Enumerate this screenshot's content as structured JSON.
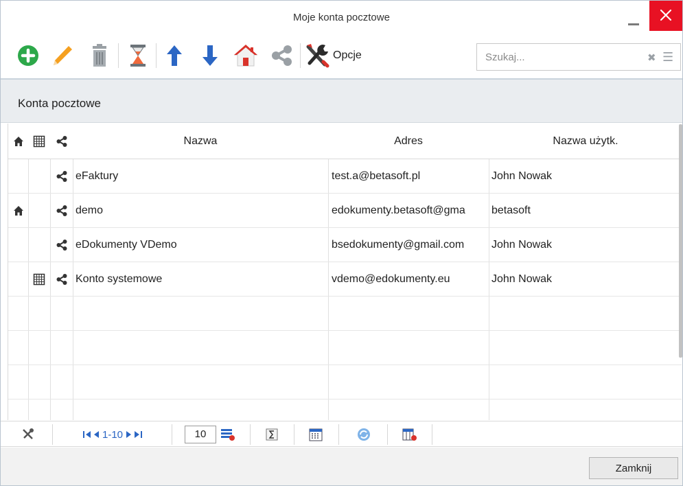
{
  "window": {
    "title": "Moje konta pocztowe"
  },
  "toolbar": {
    "opcje_label": "Opcje",
    "search_placeholder": "Szukaj...",
    "icons": [
      "plus-circle-icon",
      "pencil-icon",
      "trash-icon",
      "hourglass-icon",
      "arrow-up-icon",
      "arrow-down-icon",
      "home-icon",
      "share-icon",
      "tools-icon"
    ]
  },
  "section": {
    "title": "Konta pocztowe"
  },
  "table": {
    "headers": {
      "home": "",
      "calendar": "",
      "share": "",
      "name": "Nazwa",
      "address": "Adres",
      "username": "Nazwa użytk."
    },
    "rows": [
      {
        "home": false,
        "system": false,
        "shared": true,
        "name": "eFaktury",
        "address": "test.a@betasoft.pl",
        "username": "John Nowak"
      },
      {
        "home": true,
        "system": false,
        "shared": true,
        "name": "demo",
        "address": "edokumenty.betasoft@gma",
        "username": "betasoft"
      },
      {
        "home": false,
        "system": false,
        "shared": true,
        "name": "eDokumenty VDemo",
        "address": "bsedokumenty@gmail.com",
        "username": "John Nowak"
      },
      {
        "home": false,
        "system": true,
        "shared": true,
        "name": "Konto systemowe",
        "address": "vdemo@edokumenty.eu",
        "username": "John Nowak"
      }
    ]
  },
  "pager": {
    "range": "1-10",
    "page_size": "10"
  },
  "footer": {
    "close_label": "Zamknij"
  },
  "colors": {
    "accent_green": "#2da84a",
    "accent_blue": "#2b66c4",
    "close_red": "#e81123",
    "pencil_orange": "#f5a020",
    "home_red": "#d9332b"
  }
}
